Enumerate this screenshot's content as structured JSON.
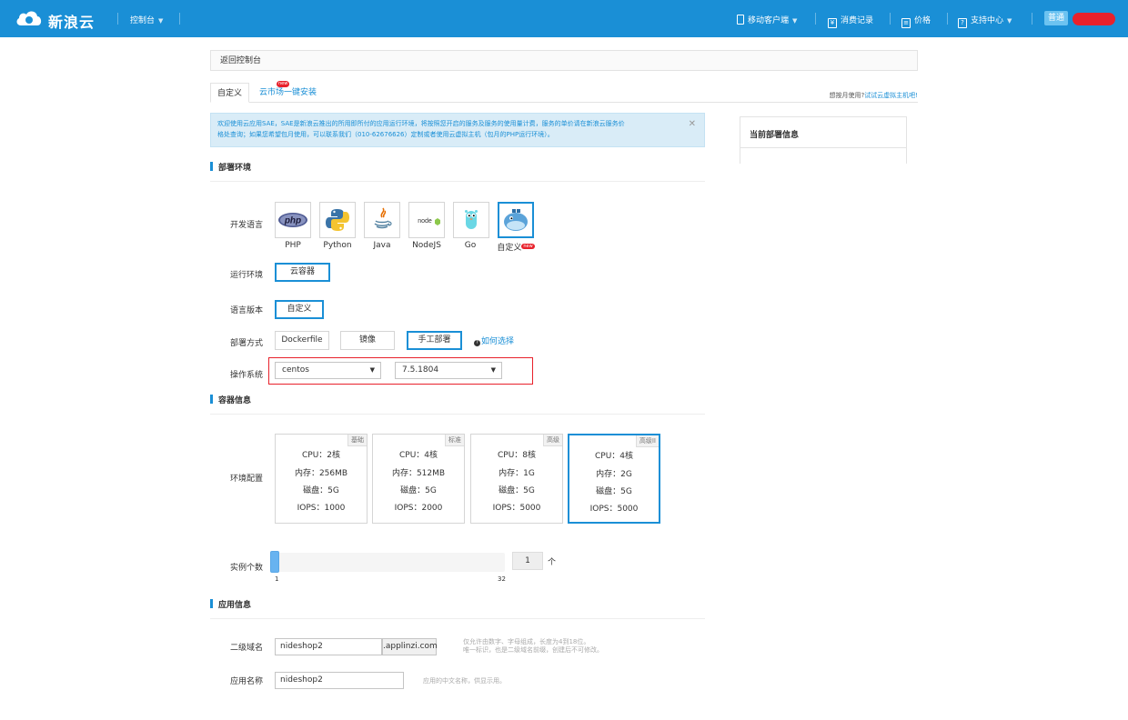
{
  "topbar": {
    "brand": "新浪云",
    "console": "控制台",
    "mobile_client": "移动客户端",
    "billing": "消费记录",
    "pricing": "价格",
    "support": "支持中心",
    "plan_badge": "普通"
  },
  "back_link": "返回控制台",
  "tabs": [
    {
      "label": "自定义",
      "active": true
    },
    {
      "label": "云市场一键安装",
      "badge": "new"
    }
  ],
  "monthly_hint": {
    "text": "想按月使用?",
    "link": "试试云虚拟主机吧!"
  },
  "notice": {
    "line1": "欢迎使用云应用SAE，SAE是新浪云推出的所用即所付的应用运行环境，将按照您开启的服务及服务的使用量计费，服务的单价请在新浪云服务价",
    "line2": "格处查询；如果您希望包月使用，可以联系我们（010-62676626）定制或者使用云虚拟主机（包月的PHP运行环境）。"
  },
  "side_panel": {
    "title": "当前部署信息"
  },
  "sections": {
    "deploy_env": "部署环境",
    "container_info": "容器信息",
    "app_info": "应用信息"
  },
  "labels": {
    "language": "开发语言",
    "runtime": "运行环境",
    "version": "语言版本",
    "deploy_method": "部署方式",
    "os": "操作系统",
    "env_config": "环境配置",
    "instances": "实例个数",
    "subdomain": "二级域名",
    "app_name": "应用名称"
  },
  "languages": [
    {
      "name": "PHP",
      "icon": "php-logo-icon"
    },
    {
      "name": "Python",
      "icon": "python-logo-icon"
    },
    {
      "name": "Java",
      "icon": "java-logo-icon"
    },
    {
      "name": "NodeJS",
      "icon": "nodejs-logo-icon"
    },
    {
      "name": "Go",
      "icon": "go-gopher-icon"
    },
    {
      "name": "自定义",
      "icon": "docker-whale-icon",
      "selected": true,
      "badge": "new"
    }
  ],
  "runtime_option": "云容器",
  "version_option": "自定义",
  "deploy_methods": [
    {
      "label": "Dockerfile"
    },
    {
      "label": "镜像"
    },
    {
      "label": "手工部署",
      "selected": true
    }
  ],
  "help_link": "如何选择",
  "os": {
    "distro": "centos",
    "version": "7.5.1804"
  },
  "specs": [
    {
      "tag": "基础",
      "cpu": "CPU：2核",
      "mem": "内存：256MB",
      "disk": "磁盘：5G",
      "iops": "IOPS：1000"
    },
    {
      "tag": "标准",
      "cpu": "CPU：4核",
      "mem": "内存：512MB",
      "disk": "磁盘：5G",
      "iops": "IOPS：2000"
    },
    {
      "tag": "高级",
      "cpu": "CPU：8核",
      "mem": "内存：1G",
      "disk": "磁盘：5G",
      "iops": "IOPS：5000"
    },
    {
      "tag": "高级II",
      "cpu": "CPU：4核",
      "mem": "内存：2G",
      "disk": "磁盘：5G",
      "iops": "IOPS：5000",
      "selected": true
    }
  ],
  "instances": {
    "min": "1",
    "max": "32",
    "value": "1",
    "unit": "个"
  },
  "subdomain": {
    "value": "nideshop2",
    "suffix": ".applinzi.com",
    "hint1": "仅允许由数字、字母组成，长度为4到18位。",
    "hint2": "唯一标识，也是二级域名前缀，创建后不可修改。"
  },
  "app_name": {
    "value": "nideshop2",
    "hint": "应用的中文名称，供显示用。"
  },
  "colors": {
    "primary": "#1a8fd6",
    "alert": "#e8212b",
    "notice_bg": "#d9ecf7"
  }
}
